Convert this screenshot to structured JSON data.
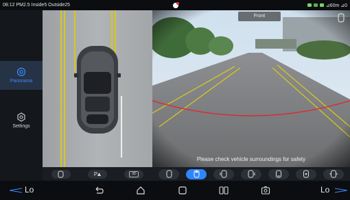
{
  "status_bar": {
    "left_text": "08:12 PM2.5 Inside5 Outside25",
    "right_text": "⊿60m ⊿0"
  },
  "sidebar": {
    "items": [
      {
        "label": "Panorama",
        "active": true,
        "icon": "panorama-icon"
      },
      {
        "label": "Settings",
        "active": false,
        "icon": "settings-icon"
      }
    ]
  },
  "camera": {
    "view_label": "Front",
    "message": "Please check vehicle surroundings for safety"
  },
  "birdview_tools": [
    {
      "icon": "car-view-icon",
      "label": ""
    },
    {
      "icon": "parking-icon",
      "label": "P"
    },
    {
      "icon": "3d-view-icon",
      "label": "3D"
    }
  ],
  "camera_tools": [
    {
      "icon": "car-front-icon",
      "active": false
    },
    {
      "icon": "car-front-active-icon",
      "active": true
    },
    {
      "icon": "car-side-left-icon",
      "active": false
    },
    {
      "icon": "car-side-right-icon",
      "active": false
    },
    {
      "icon": "car-rear-icon",
      "active": false
    },
    {
      "icon": "car-rear-left-icon",
      "active": false
    },
    {
      "icon": "car-rear-right-icon",
      "active": false
    }
  ],
  "nav_bar": {
    "left_temp": "Lo",
    "right_temp": "Lo"
  },
  "colors": {
    "accent": "#2e86ff",
    "sidebar_active_text": "#3d8bff",
    "guide_yellow": "#d9c61d",
    "guide_red": "#e2262a"
  }
}
